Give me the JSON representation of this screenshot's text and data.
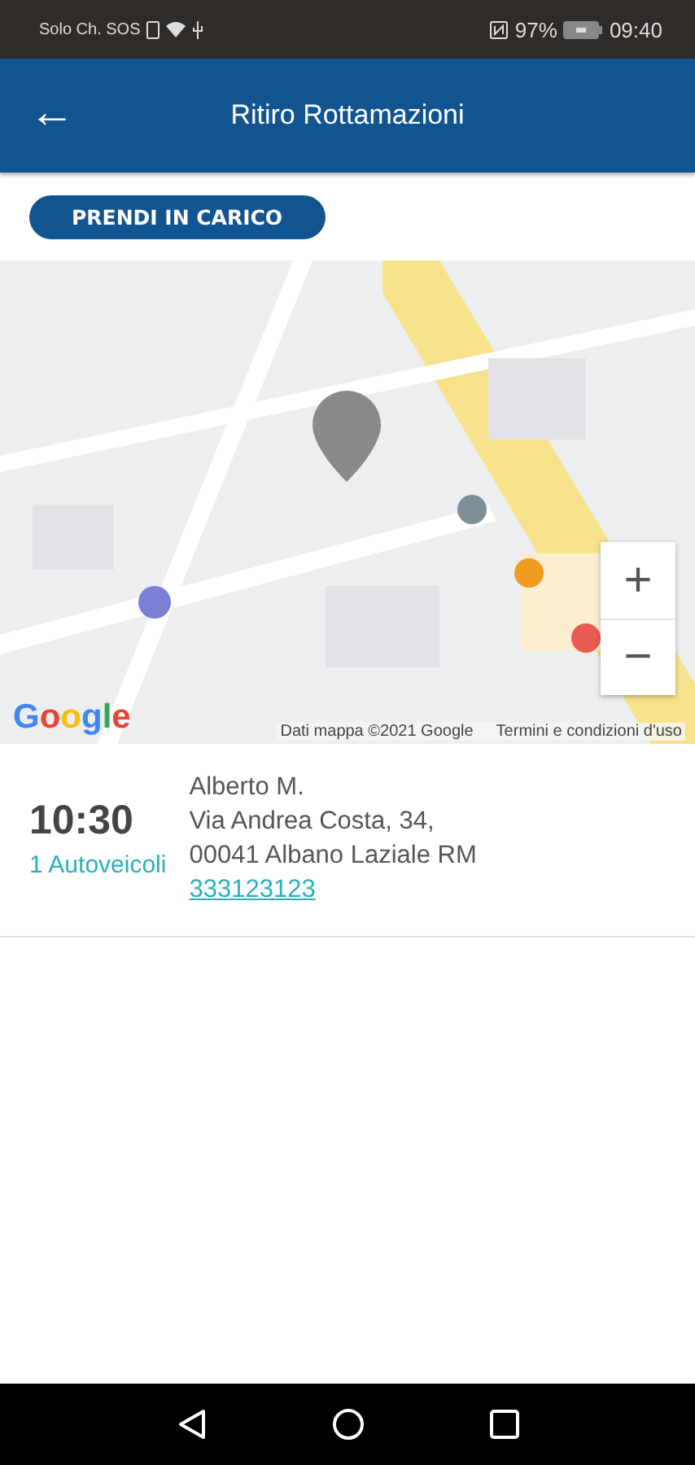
{
  "status_bar": {
    "carrier": "Solo Ch. SOS",
    "battery": "97%",
    "time": "09:40"
  },
  "app_bar": {
    "back": "←",
    "title": "Ritiro Rottamazioni"
  },
  "action_button": {
    "label": "PRENDI IN CARICO"
  },
  "map": {
    "zoom_in": "+",
    "zoom_out": "−",
    "logo": "Google",
    "attribution": "Dati mappa ©2021 Google",
    "terms": "Termini e condizioni d'uso"
  },
  "pickups": [
    {
      "time": "10:30",
      "vehicles": "1 Autoveicoli",
      "name": "Alberto M.",
      "address_line_1": "Via Andrea Costa, 34,",
      "address_line_2": "00041 Albano Laziale RM",
      "phone": "333123123"
    }
  ]
}
